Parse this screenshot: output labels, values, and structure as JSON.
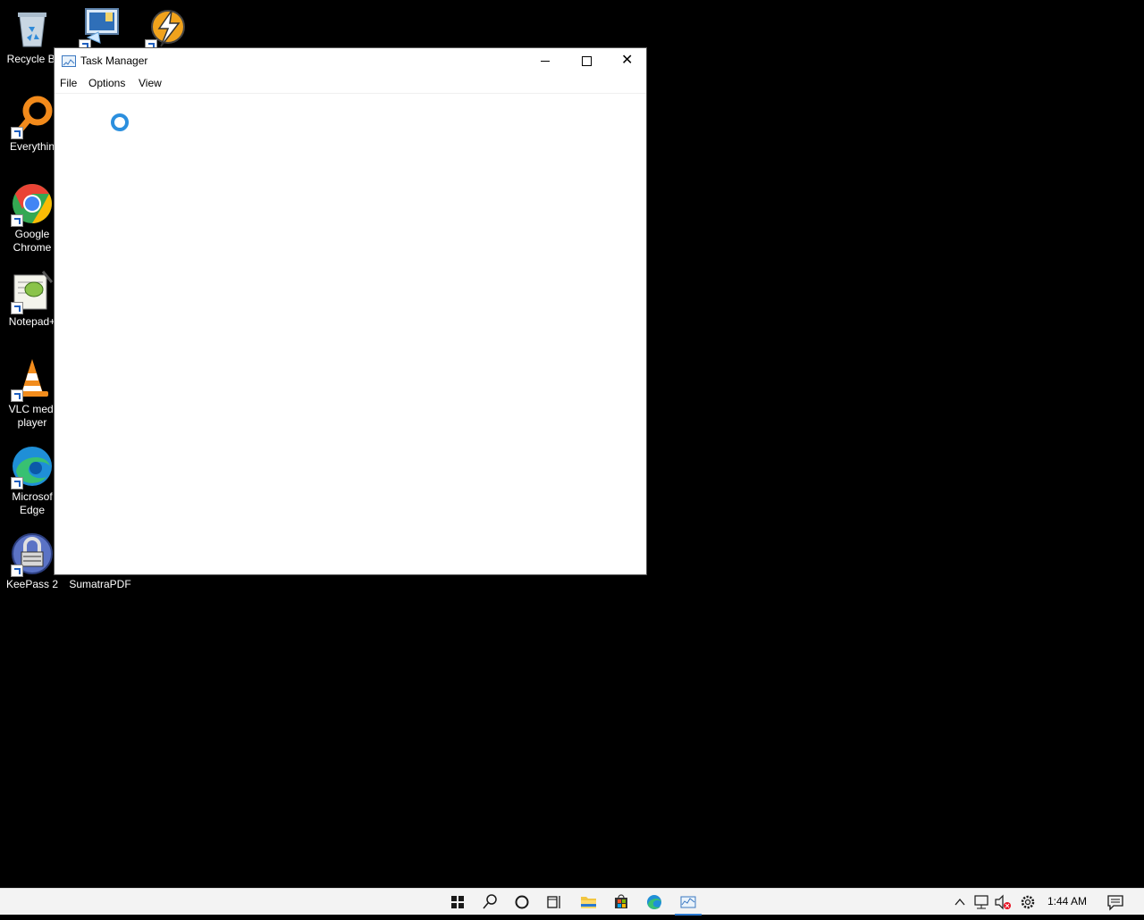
{
  "desktop": {
    "icons": [
      {
        "label": "Recycle Bi",
        "icon": "recycle-bin-icon"
      },
      {
        "label": "",
        "icon": "remote-desktop-icon"
      },
      {
        "label": "",
        "icon": "winamp-lightning-icon"
      },
      {
        "label": "Everythin",
        "icon": "everything-search-icon"
      },
      {
        "label": "Google Chrome",
        "icon": "chrome-icon"
      },
      {
        "label": "Notepad+",
        "icon": "notepad-plus-plus-icon"
      },
      {
        "label": "VLC medi player",
        "icon": "vlc-cone-icon"
      },
      {
        "label": "Microsof Edge",
        "icon": "edge-icon"
      },
      {
        "label": "KeePass 2",
        "icon": "keepass-lock-icon"
      },
      {
        "label": "SumatraPDF",
        "icon": "sumatrapdf-icon"
      }
    ]
  },
  "window": {
    "title": "Task Manager",
    "menu": [
      "File",
      "Options",
      "View"
    ],
    "controls": [
      "minimize",
      "maximize",
      "close"
    ],
    "close_glyph": "✕"
  },
  "taskbar": {
    "items": [
      "start-icon",
      "search-icon",
      "cortana-icon",
      "task-view-icon",
      "file-explorer-icon",
      "store-icon",
      "edge-icon",
      "task-manager-icon"
    ],
    "active_item": "task-manager-icon",
    "tray": [
      "chevron-up-icon",
      "network-icon",
      "volume-muted-icon",
      "settings-gear-icon"
    ],
    "clock": "1:44 AM",
    "notifications_icon": "action-center-icon"
  },
  "colors": {
    "desktop_bg": "#000000",
    "window_bg": "#ffffff",
    "accent": "#2b8fde",
    "taskbar_bg": "#f3f3f3"
  }
}
